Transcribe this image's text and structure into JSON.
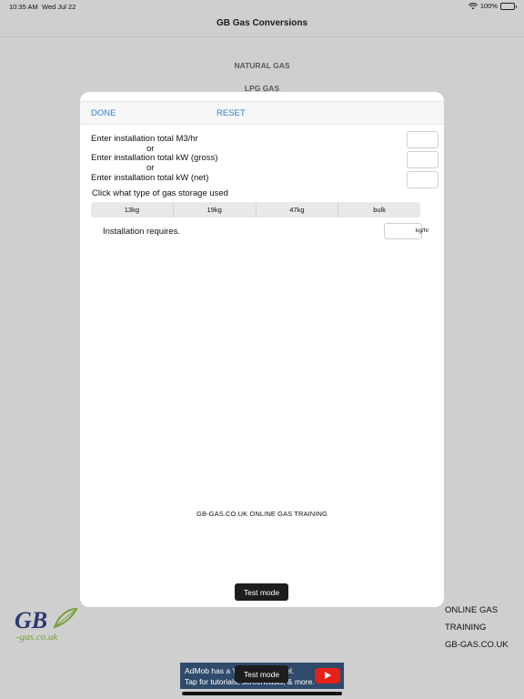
{
  "status_bar": {
    "time": "10:35 AM",
    "date": "Wed Jul 22",
    "battery": "100%"
  },
  "background": {
    "nav_title": "GB Gas Conversions",
    "menu": [
      "NATURAL GAS",
      "LPG GAS"
    ],
    "logo_text": "GB gas.co.uk",
    "links": [
      "ONLINE GAS",
      "TRAINING",
      "GB-GAS.CO.UK"
    ]
  },
  "modal": {
    "done_label": "DONE",
    "reset_label": "RESET",
    "rows": [
      {
        "label": "Enter installation total  M3/hr",
        "value": ""
      },
      {
        "label": "Enter installation total  kW (gross)",
        "value": ""
      },
      {
        "label": "Enter installation total  kW (net)",
        "value": ""
      }
    ],
    "or_label": "or",
    "storage_prompt": "Click what type of gas storage used",
    "storage_options": [
      "13kg",
      "19kg",
      "47kg",
      "bulk"
    ],
    "requires_label": "Installation requires.",
    "requires_value": "",
    "requires_unit": "kg/hr",
    "footer": "GB-GAS.CO.UK  ONLINE  GAS TRAINING",
    "test_mode": "Test mode"
  },
  "ad": {
    "line1": "AdMob has a YouTube channel.",
    "line2": "Tap for tutorials, screencasts, & more.",
    "test_mode": "Test mode"
  },
  "colors": {
    "accent": "#2f7fd6",
    "ad_background": "#2f4a6b",
    "ad_play": "#e62117"
  }
}
